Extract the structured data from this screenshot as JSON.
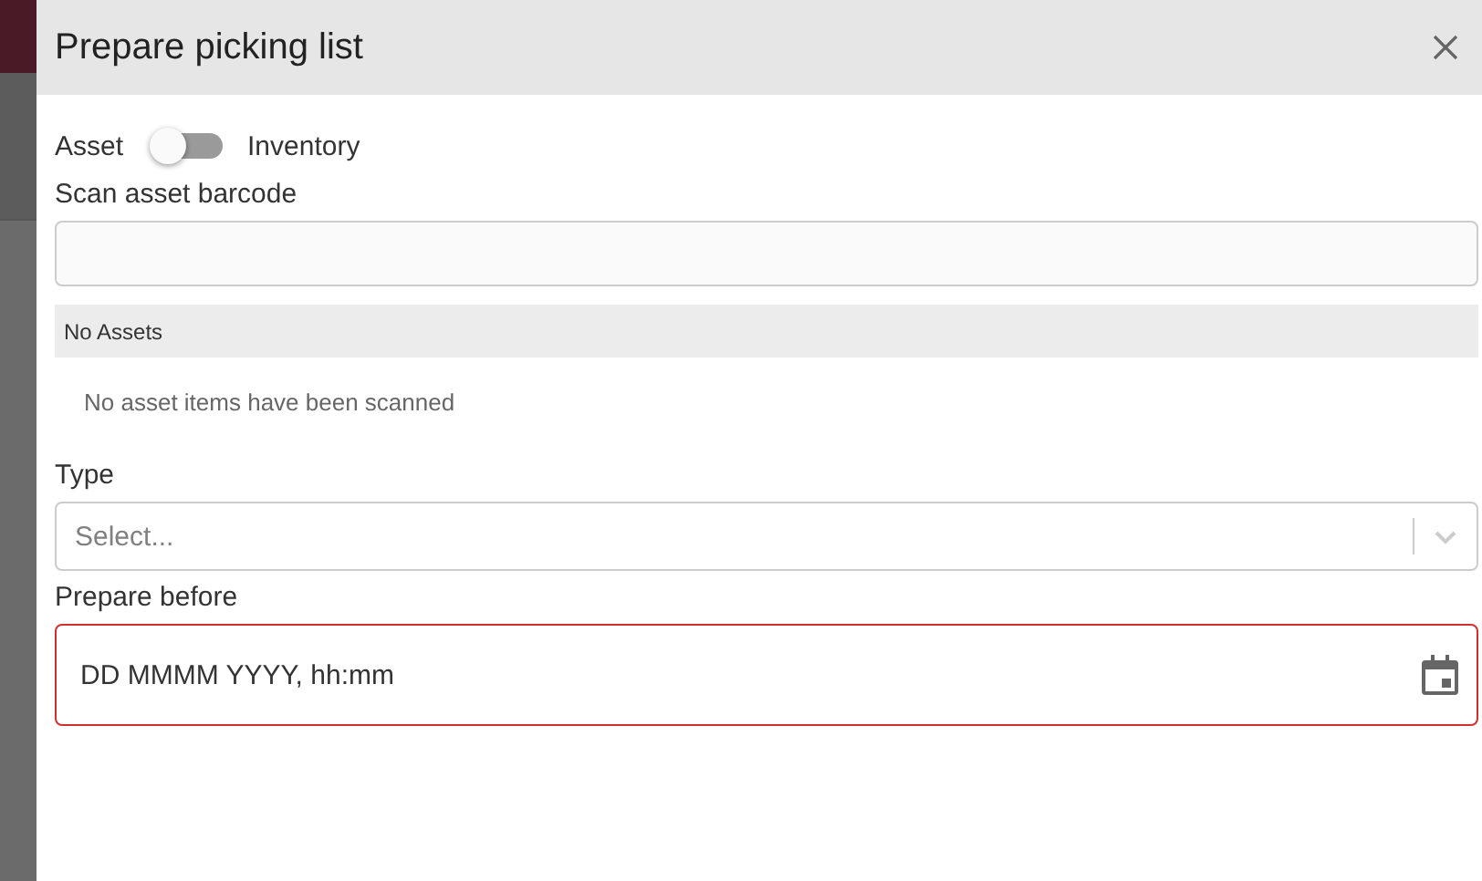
{
  "dialog": {
    "title": "Prepare picking list"
  },
  "mode_switch": {
    "left_label": "Asset",
    "right_label": "Inventory",
    "on": false
  },
  "barcode_field": {
    "label": "Scan asset barcode"
  },
  "assets_section": {
    "header": "No Assets",
    "empty_message": "No asset items have been scanned"
  },
  "type_field": {
    "label": "Type",
    "placeholder": "Select..."
  },
  "date_field": {
    "label": "Prepare before",
    "placeholder": "DD MMMM YYYY, hh:mm",
    "error": true
  }
}
